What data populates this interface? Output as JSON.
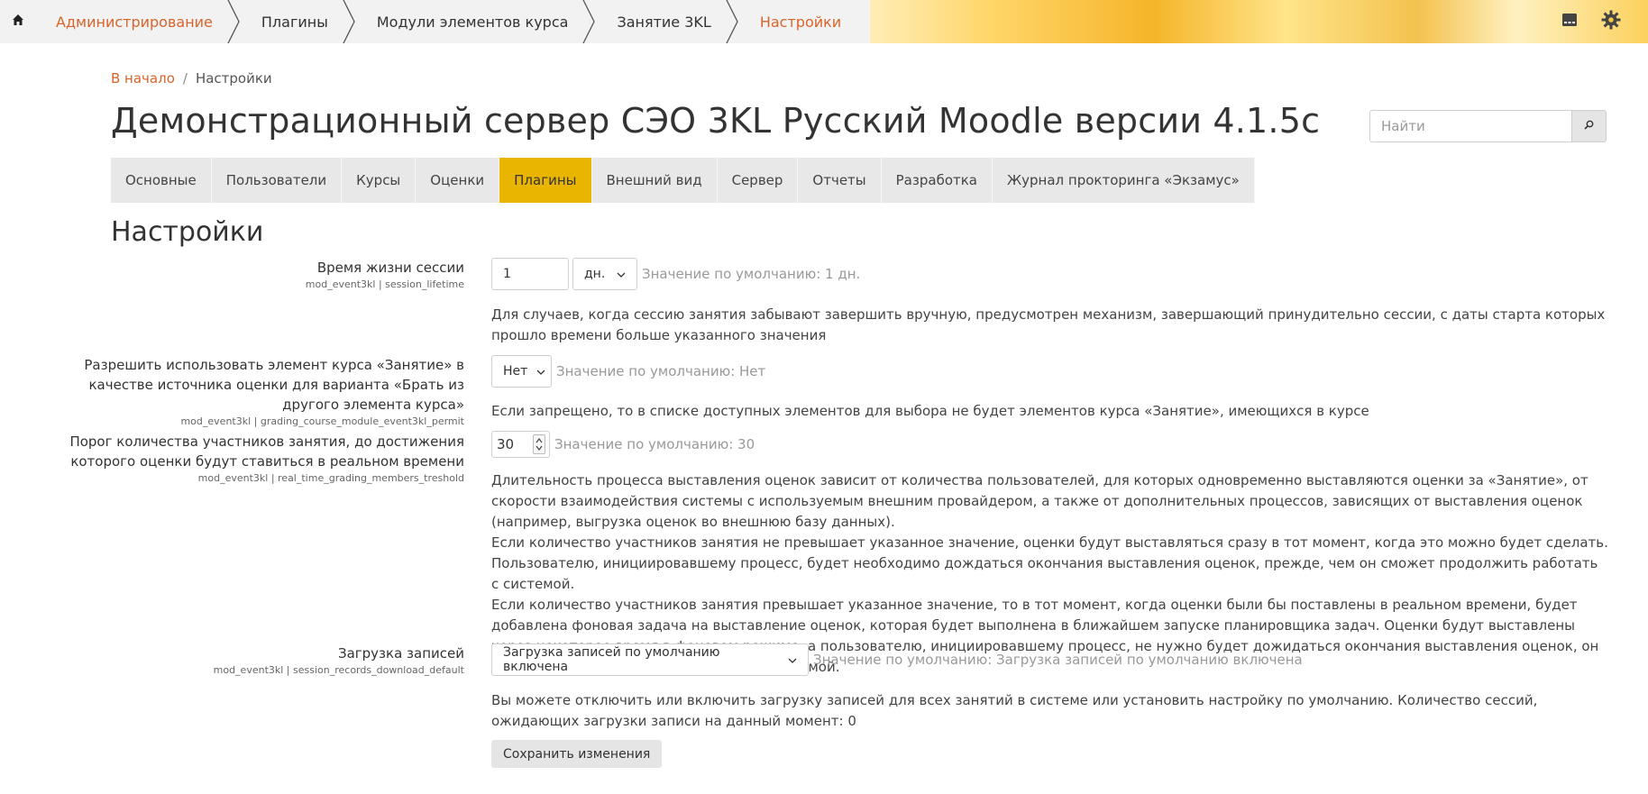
{
  "topbar": {
    "breadcrumbs": [
      {
        "label": "Администрирование"
      },
      {
        "label": "Плагины"
      },
      {
        "label": "Модули элементов курса"
      },
      {
        "label": "Занятие 3KL"
      },
      {
        "label": "Настройки"
      }
    ],
    "icons": [
      "home-icon",
      "message-drawer-icon",
      "gear-icon"
    ]
  },
  "page_breadcrumb": {
    "home": "В начало",
    "separator": "/",
    "current": "Настройки"
  },
  "site_title": "Демонстрационный сервер СЭО 3KL Русский Moodle версии 4.1.5c",
  "search": {
    "placeholder": "Найти"
  },
  "nav_tabs": [
    {
      "label": "Основные"
    },
    {
      "label": "Пользователи"
    },
    {
      "label": "Курсы"
    },
    {
      "label": "Оценки"
    },
    {
      "label": "Плагины",
      "active": true
    },
    {
      "label": "Внешний вид"
    },
    {
      "label": "Сервер"
    },
    {
      "label": "Отчеты"
    },
    {
      "label": "Разработка"
    },
    {
      "label": "Журнал прокторинга «Экзамус»"
    }
  ],
  "section_heading": "Настройки",
  "settings": {
    "session_lifetime": {
      "label": "Время жизни сессии",
      "key": "mod_event3kl | session_lifetime",
      "value": "1",
      "unit": "дн.",
      "default": "Значение по умолчанию: 1 дн.",
      "description": "Для случаев, когда сессию занятия забывают завершить вручную, предусмотрен механизм, завершающий принудительно сессии, с даты старта которых прошло времени больше указанного значения"
    },
    "grading_permit": {
      "label_lines": [
        "Разрешить использовать элемент курса «Занятие» в",
        "качестве источника оценки для варианта «Брать из",
        "другого элемента курса»"
      ],
      "key": "mod_event3kl | grading_course_module_event3kl_permit",
      "value": "Нет",
      "default": "Значение по умолчанию: Нет",
      "description": "Если запрещено, то в списке доступных элементов для выбора не будет элементов курса «Занятие», имеющихся в курсе"
    },
    "real_time_grading": {
      "label_lines": [
        "Порог количества участников занятия, до достижения",
        "которого оценки будут ставиться в реальном времени"
      ],
      "key": "mod_event3kl | real_time_grading_members_treshold",
      "value": "30",
      "default": "Значение по умолчанию: 30",
      "description_1": "Длительность процесса выставления оценок зависит от количества пользователей, для которых одновременно выставляются оценки за «Занятие», от скорости взаимодействия системы с используемым внешним провайдером, а также от дополнительных процессов, зависящих от выставления оценок (например, выгрузка оценок во внешнюю базу данных).",
      "description_2": "Если количество участников занятия не превышает указанное значение, оценки будут выставляться сразу в тот момент, когда это можно будет сделать. Пользователю, инициировавшему процесс, будет необходимо дождаться окончания выставления оценок, прежде, чем он сможет продолжить работать с системой.",
      "description_3": "Если количество участников занятия превышает указанное значение, то в тот момент, когда оценки были бы поставлены в реальном времени, будет добавлена фоновая задача на выставление оценок, которая будет выполнена в ближайшем запуске планировщика задач. Оценки будут выставлены через некоторое время в фоновом режиме, а пользователю, инициировавшему процесс, не нужно будет дожидаться окончания выставления оценок, он сможет сразу продолжить работать с системой."
    },
    "records_download": {
      "label": "Загрузка записей",
      "key": "mod_event3kl | session_records_download_default",
      "value": "Загрузка записей по умолчанию включена",
      "default": "Значение по умолчанию: Загрузка записей по умолчанию включена",
      "description": "Вы можете отключить или включить загрузку записей для всех занятий в системе или установить настройку по умолчанию. Количество сессий, ожидающих загрузки записи на данный момент: 0"
    }
  },
  "save_button": "Сохранить изменения",
  "colors": {
    "accent_link": "#d9642a",
    "active_tab": "#e9b500"
  }
}
